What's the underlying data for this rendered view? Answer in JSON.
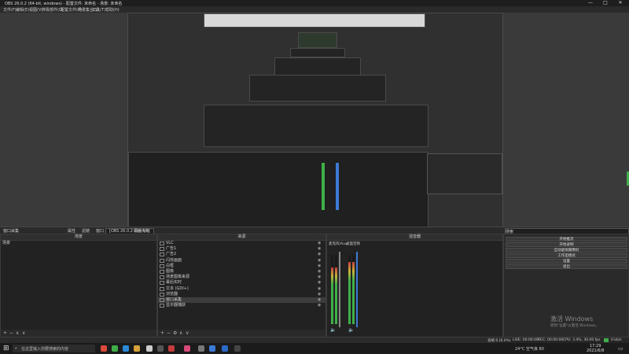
{
  "window": {
    "title": "OBS 26.0.2 (64-bit, windows) - 配置文件: 未命名 - 场景: 未命名",
    "controls": [
      "—",
      "□",
      "✕"
    ]
  },
  "menubar": [
    "文件(F)",
    "编辑(E)",
    "视图(V)",
    "停靠部件(D)",
    "配置文件(P)",
    "场景集合(S)",
    "工具(T)",
    "帮助(H)"
  ],
  "context_bar": {
    "source_label": "窗口采集",
    "properties": "属性",
    "filters": "滤镜",
    "window_label": "窗口",
    "window_value": "[OBS 26.0.2 - 64-bit]",
    "option": "覆盖光标"
  },
  "docks": {
    "scenes": {
      "title": "场景",
      "items": [
        "场景"
      ]
    },
    "sources": {
      "title": "来源",
      "items": [
        "VLC",
        "广告1",
        "广告2",
        "闪烁画面",
        "白框",
        "图像",
        "场景图像来源",
        "幕后实时",
        "文本 (GDI+)",
        "浏览器",
        "窗口采集",
        "显示器捕获"
      ],
      "selected_index": 10
    },
    "mixer": {
      "title": "混音器",
      "tracks": [
        {
          "name": "麦克风/Aux",
          "level": 0.82
        },
        {
          "name": "桌面音频",
          "level": 0.9
        }
      ]
    },
    "controls": {
      "search_placeholder": "搜索",
      "buttons": [
        "开始推流",
        "开始录制",
        "启动虚拟摄像机",
        "工作室模式",
        "设置",
        "退出"
      ]
    }
  },
  "footer_icons": [
    "+",
    "−",
    "∧",
    "∨",
    "⚙"
  ],
  "status": {
    "dropped": "丢帧 0 (0.0%)",
    "live": "LIVE: 00:00:00",
    "rec": "REC: 00:00:00",
    "cpu": "CPU: 3.4%, 30.00 fps",
    "kbps": "0 kb/s"
  },
  "watermark": {
    "line1": "激活 Windows",
    "line2": "转到\"设置\"以激活 Windows。"
  },
  "taskbar": {
    "search_placeholder": "在这里输入你要搜索的内容",
    "weather": "24°C  空气良 80",
    "time": "17:29",
    "date": "2021/6/8"
  },
  "colors": {
    "meter_green": "#3fae49",
    "meter_yellow": "#c8b43a",
    "meter_red": "#c43c3c",
    "accent_blue": "#3d7ad6"
  }
}
